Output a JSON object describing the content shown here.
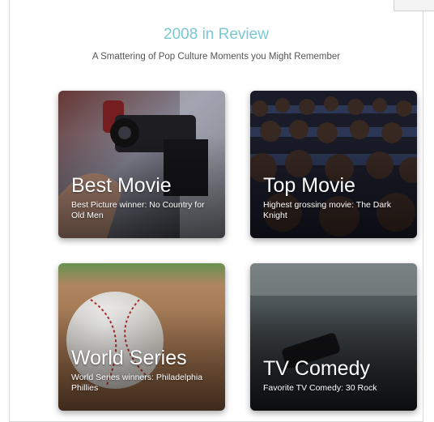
{
  "header": {
    "title": "2008 in Review",
    "subtitle": "A Smattering of Pop Culture Moments you Might Remember"
  },
  "cards": [
    {
      "title": "Best Movie",
      "description": "Best Picture winner: No Country for Old Men",
      "image": "camera-operator-photo"
    },
    {
      "title": "Top Movie",
      "description": "Highest grossing movie: The Dark Knight",
      "image": "movie-audience-photo"
    },
    {
      "title": "World Series",
      "description": "World Series winners: Philadelphia Phillies",
      "image": "baseball-photo"
    },
    {
      "title": "TV Comedy",
      "description": "Favorite TV Comedy: 30 Rock",
      "image": "tv-remote-photo"
    }
  ],
  "colors": {
    "title": "#79c8d3",
    "subtitle": "#555555",
    "card_text": "#ffffff"
  }
}
